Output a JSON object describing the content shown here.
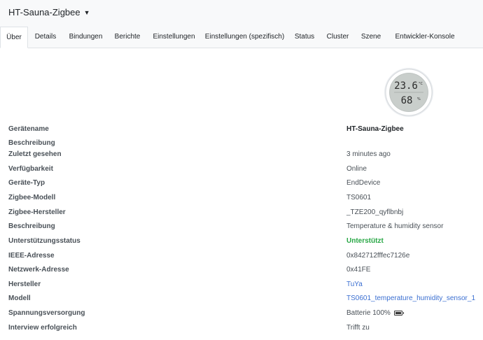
{
  "header": {
    "title": "HT-Sauna-Zigbee",
    "caret_icon": "chevron-down-icon"
  },
  "tabs": [
    {
      "label": "Über",
      "active": true
    },
    {
      "label": "Details"
    },
    {
      "label": "Bindungen"
    },
    {
      "label": "Berichte"
    },
    {
      "label": "Einstellungen"
    },
    {
      "label": "Einstellungen (spezifisch)"
    },
    {
      "label": "Status"
    },
    {
      "label": "Cluster"
    },
    {
      "label": "Szene"
    },
    {
      "label": "Entwickler-Konsole"
    }
  ],
  "device_image": {
    "display_temp": "23.6",
    "display_humidity": "68",
    "temp_unit": "°C",
    "humidity_unit": "%"
  },
  "properties": [
    {
      "label": "Gerätename",
      "value": "HT-Sauna-Zigbee",
      "style": "strong"
    },
    {
      "label": "Beschreibung",
      "value": ""
    },
    {
      "label": "Zuletzt gesehen",
      "value": "3 minutes ago"
    },
    {
      "label": "Verfügbarkeit",
      "value": "Online"
    },
    {
      "label": "Geräte-Typ",
      "value": "EndDevice"
    },
    {
      "label": "Zigbee-Modell",
      "value": "TS0601"
    },
    {
      "label": "Zigbee-Hersteller",
      "value": "_TZE200_qyflbnbj"
    },
    {
      "label": "Beschreibung",
      "value": "Temperature & humidity sensor"
    },
    {
      "label": "Unterstützungsstatus",
      "value": "Unterstützt",
      "style": "ok"
    },
    {
      "label": "IEEE-Adresse",
      "value": "0x842712fffec7126e"
    },
    {
      "label": "Netzwerk-Adresse",
      "value": "0x41FE"
    },
    {
      "label": "Hersteller",
      "value": "TuYa",
      "style": "link"
    },
    {
      "label": "Modell",
      "value": "TS0601_temperature_humidity_sensor_1",
      "style": "link"
    },
    {
      "label": "Spannungsversorgung",
      "value": "Batterie 100%",
      "battery_icon": "battery-icon",
      "battery_level": 1.0
    },
    {
      "label": "Interview erfolgreich",
      "value": "Trifft zu"
    }
  ],
  "colors": {
    "success": "#28a745",
    "link": "#3b6fd1",
    "tab_bar": "#f8f9fa"
  }
}
